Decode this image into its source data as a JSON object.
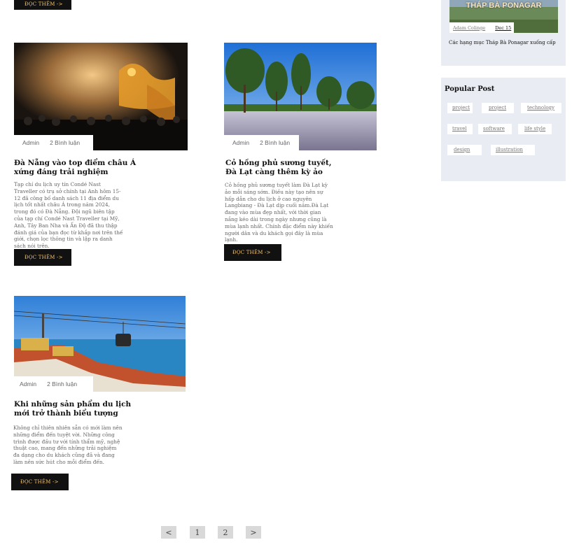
{
  "top_button": {
    "label": "ĐỌC THÊM ->"
  },
  "posts": [
    {
      "author": "Admin",
      "comments": "2 Bình luận",
      "title": "Đà Nẵng vào top điểm châu Á xứng đáng trải nghiệm",
      "excerpt": "Tạp chí du lịch uy tín Condé Nast Traveller có trụ sở chính tại Anh hôm 15-12 đã công bố danh sách 11 địa điểm du lịch tốt nhất châu Á trong năm 2024, trong đó có Đà Nẵng. Đội ngũ biên tập của tạp chí Condé Nast Traveller tại Mỹ, Anh, Tây Ban Nha và Ấn Độ đã thu thập đánh giá của bạn đọc từ khắp nơi trên thế giới, chọn lọc thông tin và lập ra danh sách nói trên.",
      "button": "ĐỌC THÊM ->"
    },
    {
      "author": "Admin",
      "comments": "2 Bình luận",
      "title": "Cỏ hồng phủ sương tuyết, Đà Lạt càng thêm kỳ ảo",
      "excerpt": "Cỏ hồng phủ sương tuyết làm Đà Lạt kỳ ảo mỗi sáng sớm. Điều này tạo nên sự hấp dẫn cho du lịch ở cao nguyên Langbiang - Đà Lạt dịp cuối năm.Đà Lạt đang vào mùa đẹp nhất, với thời gian nắng kéo dài trong ngày nhưng cũng là mùa lạnh nhất. Chính đặc điểm này khiến người dân và du khách gọi đây là mùa lạnh.",
      "button": "ĐỌC THÊM ->"
    },
    {
      "author": "Admin",
      "comments": "2 Bình luận",
      "title": "Khi những sản phẩm du lịch mới trở thành biểu tượng",
      "excerpt": "Không chỉ thiên nhiên sẵn có mới làm nên những điểm đến tuyệt vời. Những công trình được đầu tư với tính thẩm mỹ, nghệ thuật cao, mang đến những trải nghiệm đa dạng cho du khách cũng đã và đang làm nên sức hút cho mỗi điểm đến.",
      "button": "ĐỌC THÊM ->"
    }
  ],
  "sidebar": {
    "recent": {
      "image_text": "THÁP BÀ PONAGAR",
      "author": "Adam Colinge",
      "date": "Dec 15",
      "title": "Các hạng mục Tháp Bà Ponagar xuống cấp"
    },
    "popular": {
      "heading": "Popular Post",
      "tags": [
        "project",
        "project",
        "technology",
        "travel",
        "software",
        "life style",
        "design",
        "illustration"
      ]
    }
  },
  "pagination": {
    "prev": "<",
    "pages": [
      "1",
      "2"
    ],
    "next": ">"
  }
}
